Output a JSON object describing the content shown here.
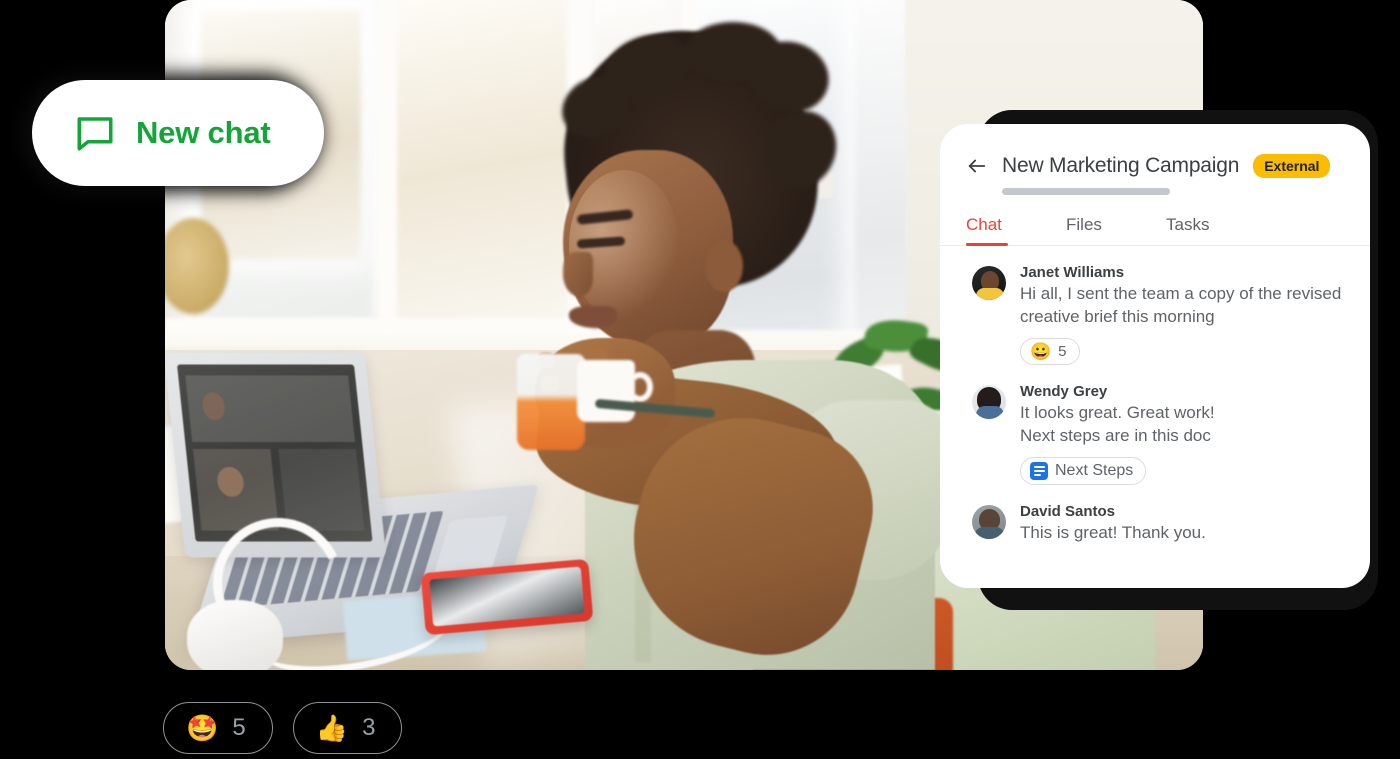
{
  "new_chat_button": {
    "label": "New chat",
    "icon": "chat-bubble-icon",
    "color": "#13a538"
  },
  "photo": {
    "alt": "Person sitting at a sunlit desk with a laptop video call, headphones and a phone"
  },
  "chat_panel": {
    "back_icon": "back-arrow-icon",
    "title": "New Marketing Campaign",
    "badge": "External",
    "badge_color": "#FBBC04",
    "tabs": [
      {
        "label": "Chat",
        "active": true
      },
      {
        "label": "Files",
        "active": false
      },
      {
        "label": "Tasks",
        "active": false
      }
    ],
    "active_tab_color": "#EA4335",
    "messages": [
      {
        "author": "Janet Williams",
        "text": "Hi all, I sent the team a copy of the revised creative brief this morning",
        "reaction": {
          "emoji": "😀",
          "count": "5"
        }
      },
      {
        "author": "Wendy Grey",
        "text": "It looks great. Great work!\nNext steps are in this doc",
        "attachment": {
          "icon": "google-docs-icon",
          "label": "Next Steps"
        }
      },
      {
        "author": "David Santos",
        "text": "This is great! Thank you."
      }
    ]
  },
  "reactions": [
    {
      "emoji": "🤩",
      "count": "5",
      "name": "star-struck"
    },
    {
      "emoji": "👍",
      "count": "3",
      "name": "thumbs-up"
    }
  ]
}
